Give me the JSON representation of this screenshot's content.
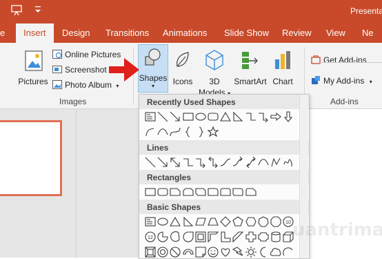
{
  "title_bar": {
    "title": "Presenta"
  },
  "tabs": [
    {
      "label": "e",
      "active": false
    },
    {
      "label": "Insert",
      "active": true
    },
    {
      "label": "Design",
      "active": false
    },
    {
      "label": "Transitions",
      "active": false
    },
    {
      "label": "Animations",
      "active": false
    },
    {
      "label": "Slide Show",
      "active": false
    },
    {
      "label": "Review",
      "active": false
    },
    {
      "label": "View",
      "active": false
    },
    {
      "label": "Ne",
      "active": false
    }
  ],
  "ribbon": {
    "images": {
      "group_label": "Images",
      "pictures": "Pictures",
      "online_pictures": "Online Pictures",
      "screenshot": "Screenshot",
      "photo_album": "Photo Album"
    },
    "illustrations": {
      "shapes": "Shapes",
      "icons": "Icons",
      "models_top": "3D",
      "models_bottom": "Models",
      "smartart": "SmartArt",
      "chart": "Chart"
    },
    "addins": {
      "group_label": "Add-ins",
      "get_addins": "Get Add-ins",
      "my_addins": "My Add-ins"
    }
  },
  "gallery": {
    "sections": [
      {
        "title": "Recently Used Shapes",
        "shapes": [
          "text-box",
          "line",
          "arrow-line",
          "rectangle",
          "oval",
          "rounded-rectangle",
          "triangle",
          "right-triangle",
          "elbow-connector",
          "elbow-arrow-connector",
          "right-arrow",
          "down-arrow",
          "left-brace",
          "curve",
          "s-curve",
          "open-brace",
          "close-brace",
          "star"
        ]
      },
      {
        "title": "Lines",
        "shapes": [
          "line",
          "arrow-line",
          "double-arrow-line",
          "elbow-connector",
          "elbow-arrow-connector",
          "elbow-double-arrow",
          "curved-connector",
          "curved-arrow",
          "curved-double-arrow",
          "curve",
          "freeform",
          "scribble"
        ]
      },
      {
        "title": "Rectangles",
        "shapes": [
          "rectangle",
          "rounded-rectangle",
          "snip-single-corner",
          "snip-same-side",
          "snip-diagonal",
          "round-single-corner",
          "round-same-side",
          "round-diagonal",
          "snip-round"
        ]
      },
      {
        "title": "Basic Shapes",
        "shapes": [
          "text-box",
          "oval",
          "triangle",
          "right-triangle",
          "parallelogram",
          "trapezoid",
          "diamond",
          "pentagon",
          "hexagon",
          "heptagon",
          "octagon",
          "decagon",
          "dodecagon",
          "pie",
          "chord",
          "teardrop",
          "frame",
          "half-frame",
          "l-shape",
          "diagonal-stripe",
          "cross",
          "plaque",
          "can",
          "cube",
          "bevel",
          "donut",
          "no-symbol",
          "block-arc",
          "folded-corner",
          "smiley",
          "heart",
          "lightning",
          "sun",
          "moon",
          "cloud",
          "arc"
        ]
      }
    ],
    "watermark": "uantrimang"
  },
  "colors": {
    "accent": "#c94a2a",
    "ribbon_bg": "#f3f3f3",
    "selected": "#c7dff4",
    "arrow": "#e0201b"
  }
}
